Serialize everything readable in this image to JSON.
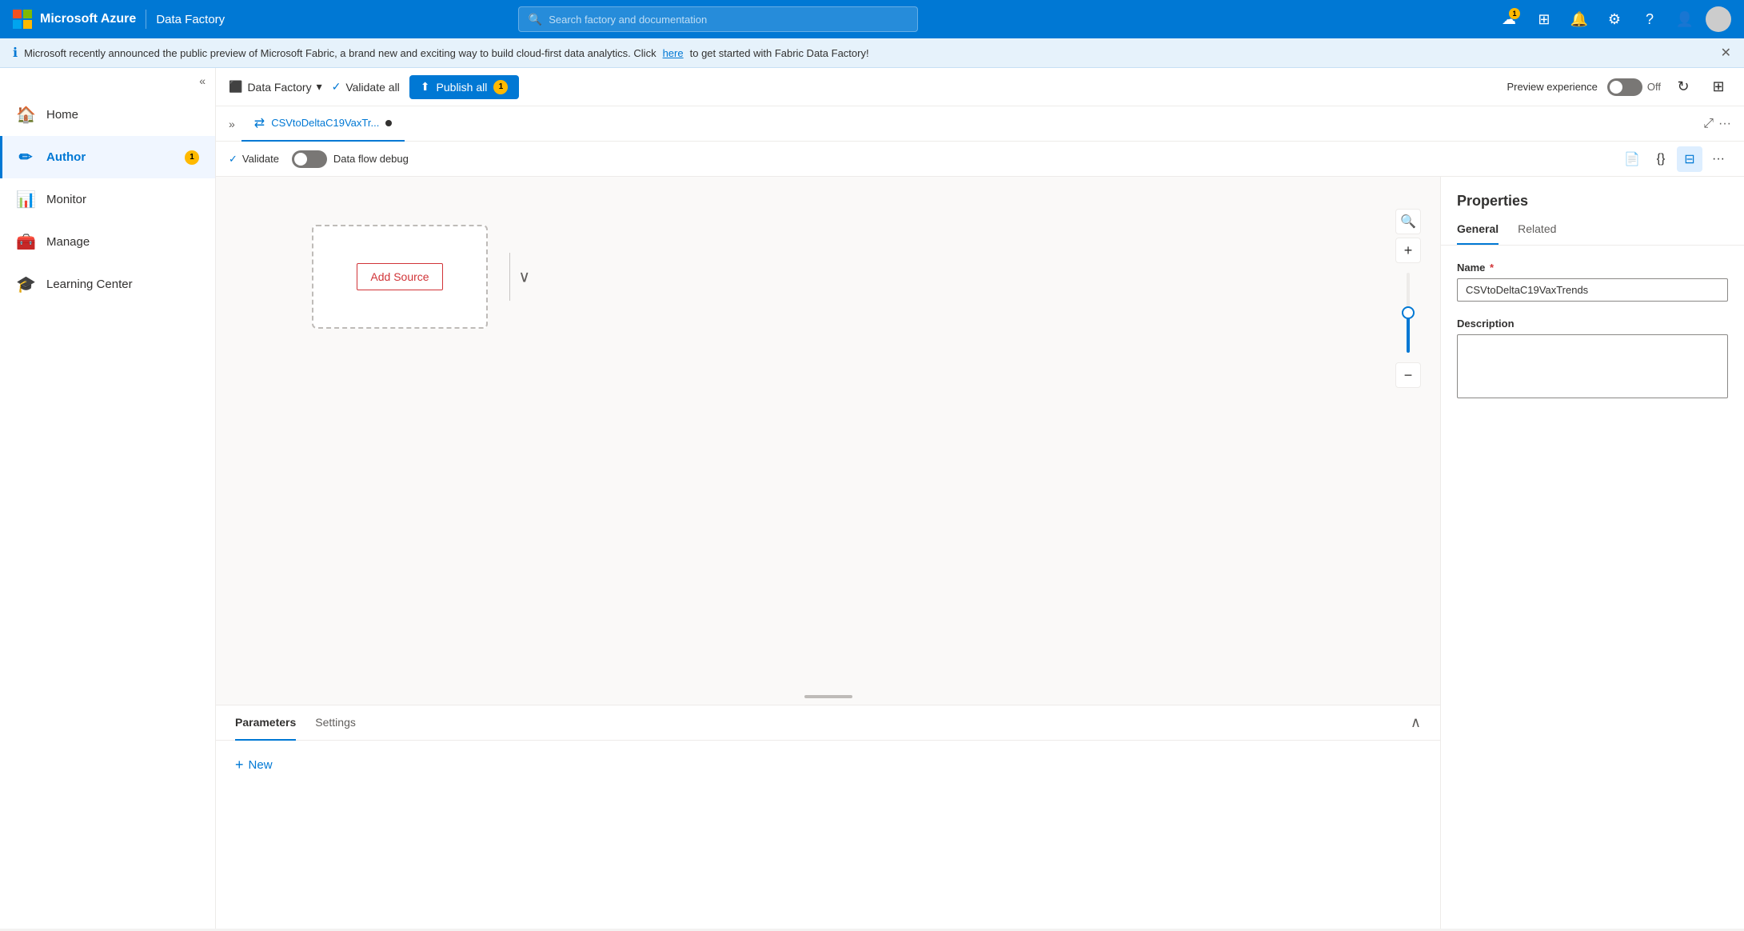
{
  "app": {
    "brand": "Microsoft Azure",
    "service": "Data Factory"
  },
  "top_nav": {
    "search_placeholder": "Search factory and documentation",
    "notifications_count": "1",
    "icons": [
      "cloud-icon",
      "monitor-icon",
      "bell-icon",
      "gear-icon",
      "help-icon",
      "people-icon"
    ]
  },
  "info_banner": {
    "text": "Microsoft recently announced the public preview of Microsoft Fabric, a brand new and exciting way to build cloud-first data analytics. Click ",
    "link_text": "here",
    "text_after": " to get started with Fabric Data Factory!"
  },
  "toolbar": {
    "factory_btn_label": "Data Factory",
    "validate_label": "Validate all",
    "publish_label": "Publish all",
    "publish_count": "1",
    "preview_label": "Preview experience",
    "toggle_off_label": "Off"
  },
  "tab_bar": {
    "tab_name": "CSVtoDeltaC19VaxTr...",
    "tab_icon": "dataflow-icon"
  },
  "dataflow_toolbar": {
    "validate_label": "Validate",
    "debug_label": "Data flow debug"
  },
  "source_node": {
    "add_source_label": "Add Source"
  },
  "bottom_panel": {
    "tabs": [
      "Parameters",
      "Settings"
    ],
    "active_tab": "Parameters",
    "new_btn_label": "New"
  },
  "properties_panel": {
    "title": "Properties",
    "tabs": [
      "General",
      "Related"
    ],
    "active_tab": "General",
    "name_label": "Name",
    "name_value": "CSVtoDeltaC19VaxTrends",
    "description_label": "Description",
    "description_value": ""
  },
  "sidebar": {
    "items": [
      {
        "label": "Home",
        "icon": "home-icon",
        "badge": ""
      },
      {
        "label": "Author",
        "icon": "author-icon",
        "badge": "1"
      },
      {
        "label": "Monitor",
        "icon": "monitor-icon",
        "badge": ""
      },
      {
        "label": "Manage",
        "icon": "manage-icon",
        "badge": ""
      },
      {
        "label": "Learning Center",
        "icon": "learn-icon",
        "badge": ""
      }
    ]
  }
}
